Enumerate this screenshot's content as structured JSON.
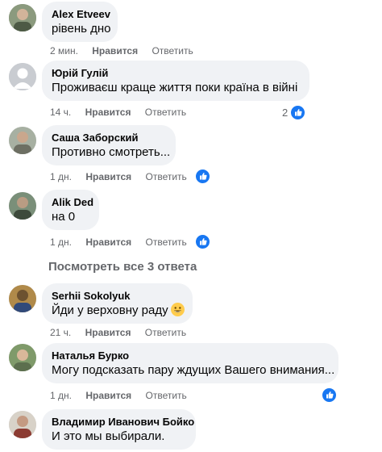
{
  "comments": [
    {
      "author": "Alex Etveev",
      "text": "рівень дно",
      "time": "2 мин.",
      "like": "Нравится",
      "reply": "Ответить",
      "reactions": null
    },
    {
      "author": "Юрій Гулій",
      "text": "Проживаєш краще життя поки країна в війні",
      "time": "14 ч.",
      "like": "Нравится",
      "reply": "Ответить",
      "reactions": "2"
    },
    {
      "author": "Саша Заборский",
      "text": "Противно смотреть...",
      "time": "1 дн.",
      "like": "Нравится",
      "reply": "Ответить",
      "reactions": ""
    },
    {
      "author": "Alik Ded",
      "text": "на 0",
      "time": "1 дн.",
      "like": "Нравится",
      "reply": "Ответить",
      "reactions": ""
    },
    {
      "author": "Serhii Sokolyuk",
      "text": "Йди у верховну раду",
      "time": "21 ч.",
      "like": "Нравится",
      "reply": "Ответить",
      "reactions": null
    },
    {
      "author": "Наталья Бурко",
      "text": "Могу подсказать пару ждущих Вашего внимания...",
      "time": "1 дн.",
      "like": "Нравится",
      "reply": "Ответить",
      "reactions": ""
    },
    {
      "author": "Владимир Иванович Бойко",
      "text": "И это мы выбирали.",
      "time": "",
      "like": "",
      "reply": "",
      "reactions": null
    }
  ],
  "more_replies": "Посмотреть все 3 ответа",
  "icons": {
    "like": "thumbs-up-icon",
    "emoji": "grinning-emoji",
    "avatar_default": "default-avatar-icon"
  },
  "colors": {
    "accent": "#1877f2",
    "bubble": "#f0f2f5",
    "meta": "#65676b"
  }
}
